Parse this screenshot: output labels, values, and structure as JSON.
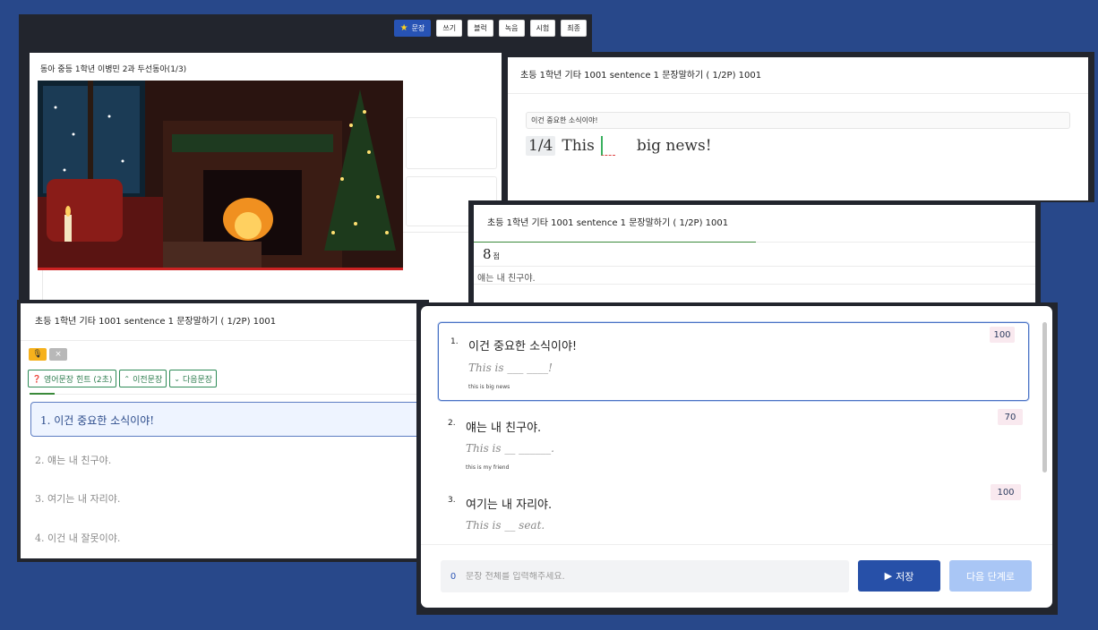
{
  "toolbar": {
    "tabs": [
      "문장",
      "쓰기",
      "블럭",
      "녹음",
      "시험",
      "최종"
    ]
  },
  "video_window": {
    "title": "동아 중등 1학년 이병민 2과 두선동아(1/3)"
  },
  "fill_window": {
    "title": "초등 1학년 기타 1001 sentence 1 문장말하기 ( 1/2P) 1001",
    "hint": "이건 중요한 소식이야!",
    "counter": "1/4",
    "word1": "This",
    "word2": "big",
    "word3": "news!"
  },
  "score_window": {
    "title": "초등 1학년 기타 1001 sentence 1 문장말하기 ( 1/2P) 1001",
    "score": "8",
    "score_unit": "점",
    "sentence": "얘는 내 친구야."
  },
  "list_window": {
    "title": "초등 1학년 기타 1001 sentence 1 문장말하기 ( 1/2P) 1001",
    "hint_btn": "영어문장 힌트 (2초)",
    "prev_btn": "이전문장",
    "next_btn": "다음문장",
    "items": [
      "1. 이건 중요한 소식이야!",
      "2. 얘는 내 친구야.",
      "3. 여기는 내 자리야.",
      "4. 이건 내 잘못이야."
    ]
  },
  "quiz_window": {
    "questions": [
      {
        "num": "1.",
        "korean": "이건 중요한 소식이야!",
        "pattern": "This is ___ ____!",
        "answer": "this is big news",
        "score": "100"
      },
      {
        "num": "2.",
        "korean": "얘는 내 친구야.",
        "pattern": "This is __ ______.",
        "answer": "this is my friend",
        "score": "70"
      },
      {
        "num": "3.",
        "korean": "여기는 내 자리야.",
        "pattern": "This is __ seat.",
        "answer": "",
        "score": "100"
      }
    ],
    "input_count": "0",
    "input_placeholder": "문장 전체를 입력해주세요.",
    "save_label": "저장",
    "next_label": "다음 단계로"
  },
  "colors": {
    "background": "#28488a",
    "primary": "#2750a8",
    "mic": "#f6b11c",
    "green": "#2e8b57"
  }
}
